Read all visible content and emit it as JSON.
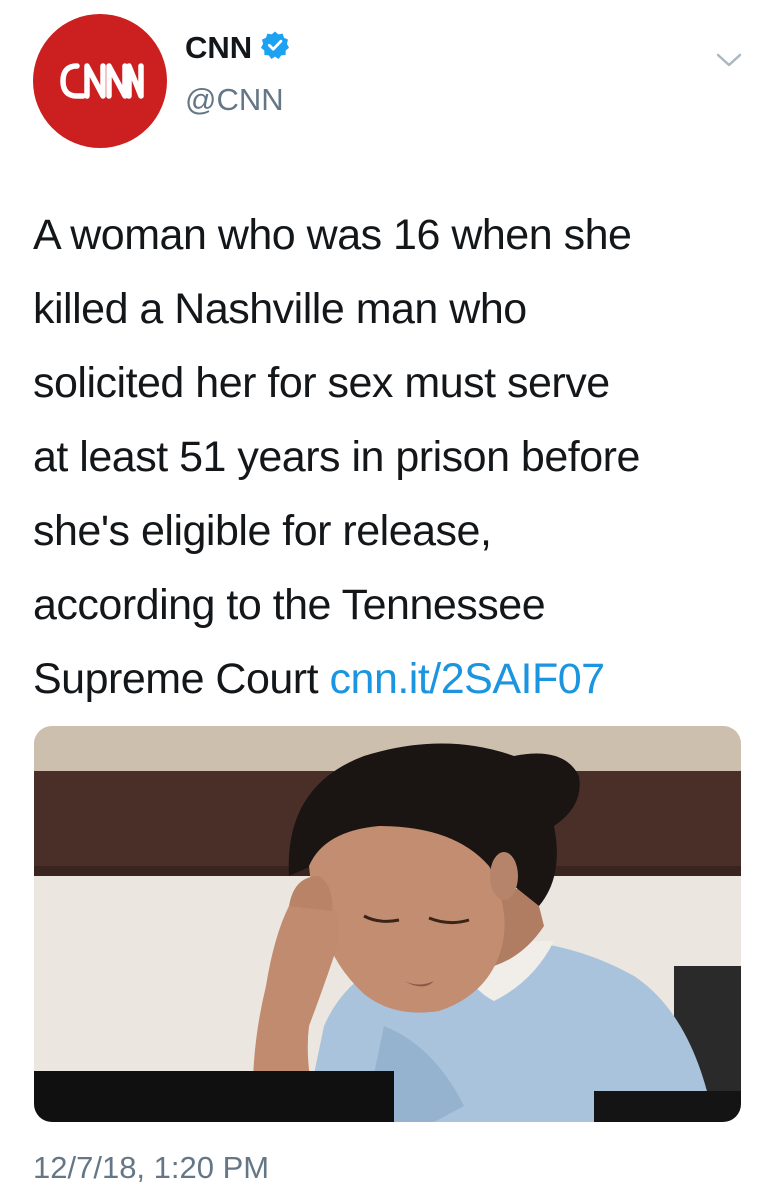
{
  "author": {
    "display_name": "CNN",
    "handle": "@CNN",
    "verified": true,
    "avatar_logo": "CNN",
    "avatar_color": "#cc1f1f"
  },
  "menu_icon": "chevron-down-icon",
  "tweet": {
    "lines": [
      "A woman who was 16 when she",
      "killed a Nashville man who",
      "solicited her for sex must serve",
      "at least 51 years in prison before",
      "she's eligible for release,",
      "according to the Tennessee",
      "Supreme Court "
    ],
    "link": "cnn.it/2SAIF07"
  },
  "timestamp": "12/7/18, 1:20 PM",
  "colors": {
    "link": "#1b95e0",
    "secondary_text": "#657786",
    "verified_badge": "#1da1f2"
  }
}
